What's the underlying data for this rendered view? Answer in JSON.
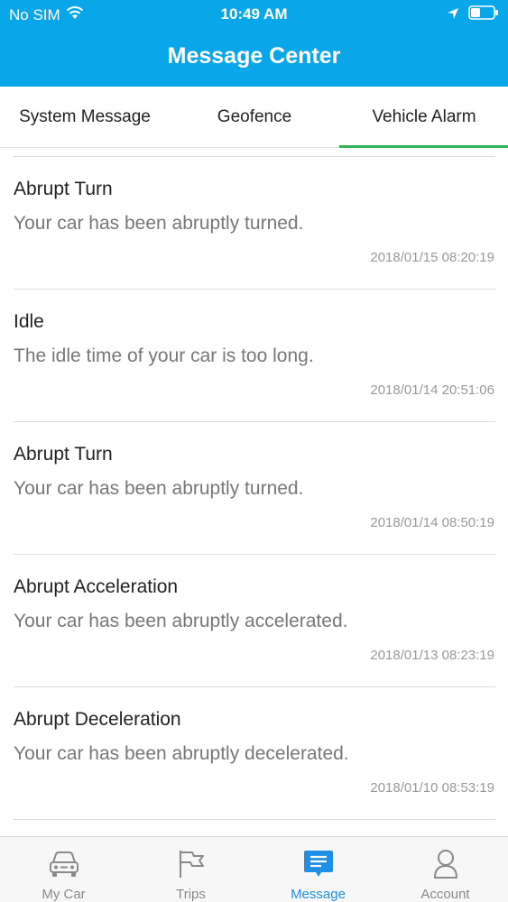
{
  "status_bar": {
    "carrier": "No SIM",
    "time": "10:49 AM"
  },
  "header": {
    "title": "Message Center"
  },
  "tabs": [
    {
      "label": "System Message",
      "active": false
    },
    {
      "label": "Geofence",
      "active": false
    },
    {
      "label": "Vehicle Alarm",
      "active": true
    }
  ],
  "messages": [
    {
      "title": "Abrupt Turn",
      "body": "Your car has been abruptly turned.",
      "time": "2018/01/15 08:20:19"
    },
    {
      "title": "Idle",
      "body": "The idle time of your car is too long.",
      "time": "2018/01/14 20:51:06"
    },
    {
      "title": "Abrupt Turn",
      "body": "Your car has been abruptly turned.",
      "time": "2018/01/14 08:50:19"
    },
    {
      "title": "Abrupt Acceleration",
      "body": "Your car has been abruptly accelerated.",
      "time": "2018/01/13 08:23:19"
    },
    {
      "title": "Abrupt Deceleration",
      "body": "Your car has been abruptly decelerated.",
      "time": "2018/01/10 08:53:19"
    }
  ],
  "tabbar": [
    {
      "label": "My Car",
      "icon": "car-icon",
      "active": false
    },
    {
      "label": "Trips",
      "icon": "flag-icon",
      "active": false
    },
    {
      "label": "Message",
      "icon": "message-icon",
      "active": true
    },
    {
      "label": "Account",
      "icon": "user-icon",
      "active": false
    }
  ],
  "colors": {
    "header_bg": "#0aa6ea",
    "tab_indicator": "#34b45a",
    "tabbar_active": "#1f8fe6"
  }
}
